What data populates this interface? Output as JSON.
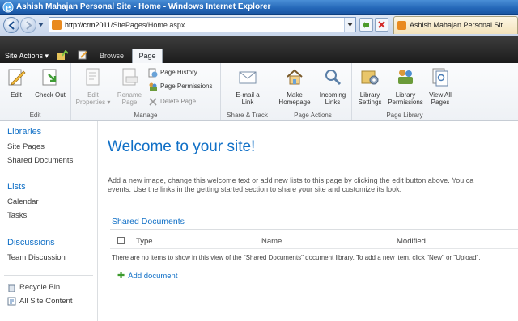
{
  "browser": {
    "window_title": "Ashish Mahajan Personal Site - Home - Windows Internet Explorer",
    "url_host": "http://crm2011",
    "url_path": "/SitePages/Home.aspx",
    "tab_title": "Ashish Mahajan Personal Sit..."
  },
  "topbar": {
    "site_actions": "Site Actions ▾",
    "tabs": [
      {
        "label": "Browse",
        "active": false
      },
      {
        "label": "Page",
        "active": true
      }
    ]
  },
  "ribbon": {
    "groups": [
      {
        "label": "Edit",
        "buttons": [
          "Edit",
          "Check Out"
        ]
      },
      {
        "label": "Manage",
        "buttons": [
          "Edit Properties",
          "Rename Page"
        ],
        "small": [
          "Page History",
          "Page Permissions",
          "Delete Page"
        ]
      },
      {
        "label": "Share & Track",
        "buttons": [
          "E-mail a Link"
        ]
      },
      {
        "label": "Page Actions",
        "buttons": [
          "Make Homepage",
          "Incoming Links"
        ]
      },
      {
        "label": "Page Library",
        "buttons": [
          "Library Settings",
          "Library Permissions",
          "View All Pages"
        ]
      }
    ],
    "edit": {
      "l1": "Edit",
      "l2": "Check Out"
    },
    "manage": {
      "ep1": "Edit",
      "ep2": "Properties ▾",
      "rn1": "Rename",
      "rn2": "Page",
      "history": "Page History",
      "permissions": "Page Permissions",
      "delete": "Delete Page"
    },
    "share": {
      "l1": "E-mail a",
      "l2": "Link"
    },
    "actions": {
      "mh1": "Make",
      "mh2": "Homepage",
      "il1": "Incoming",
      "il2": "Links"
    },
    "library": {
      "ls1": "Library",
      "ls2": "Settings",
      "lp1": "Library",
      "lp2": "Permissions",
      "va1": "View All",
      "va2": "Pages"
    },
    "group_labels": {
      "edit": "Edit",
      "manage": "Manage",
      "share": "Share & Track",
      "actions": "Page Actions",
      "library": "Page Library"
    }
  },
  "leftnav": {
    "libraries": {
      "heading": "Libraries",
      "items": [
        "Site Pages",
        "Shared Documents"
      ]
    },
    "lists": {
      "heading": "Lists",
      "items": [
        "Calendar",
        "Tasks"
      ]
    },
    "discussions": {
      "heading": "Discussions",
      "items": [
        "Team Discussion"
      ]
    },
    "recycle_bin": "Recycle Bin",
    "all_site_content": "All Site Content"
  },
  "main": {
    "title": "Welcome to your site!",
    "intro_line1": "Add a new image, change this welcome text or add new lists to this page by clicking the edit button above. You ca",
    "intro_line2": "events. Use the links in the getting started section to share your site and customize its look.",
    "webpart": {
      "title": "Shared Documents",
      "columns": [
        "Type",
        "Name",
        "Modified"
      ],
      "empty_message": "There are no items to show in this view of the \"Shared Documents\" document library. To add a new item, click \"New\" or \"Upload\".",
      "add_link": "Add document"
    }
  },
  "colors": {
    "sp_blue": "#0f6fc6",
    "ie_titlebar": "#2467b8",
    "sp_topbar": "#2b2b2b"
  }
}
